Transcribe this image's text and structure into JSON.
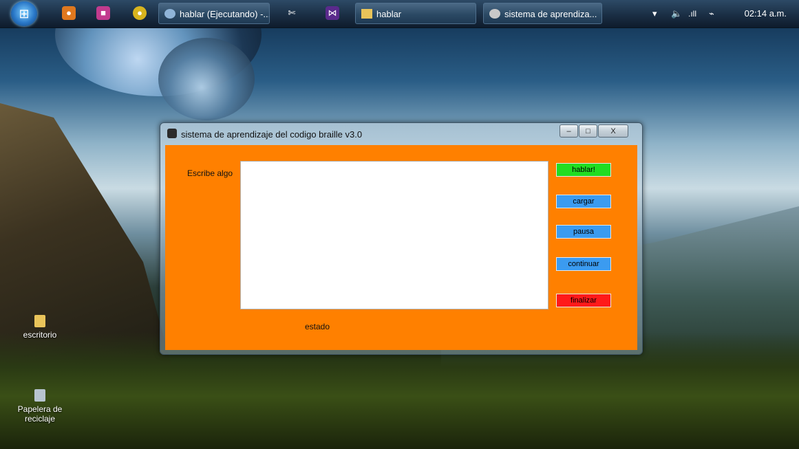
{
  "taskbar": {
    "tasks": [
      {
        "label": "hablar (Ejecutando) -..."
      },
      {
        "label": "hablar"
      },
      {
        "label": "sistema de aprendiza..."
      }
    ],
    "clock": "02:14 a.m."
  },
  "desktop": {
    "icons": [
      {
        "label": "escritorio"
      },
      {
        "label": "Papelera de reciclaje"
      }
    ]
  },
  "window": {
    "title": "sistema de aprendizaje del codigo braille v3.0",
    "minimize_glyph": "–",
    "maximize_glyph": "□",
    "close_glyph": "X",
    "input_label": "Escribe algo",
    "text_value": "",
    "status_label": "estado",
    "buttons": {
      "hablar": "hablar!",
      "cargar": "cargar",
      "pausa": "pausa",
      "continuar": "continuar",
      "finalizar": "finalizar"
    }
  },
  "colors": {
    "client_bg": "#ff8000",
    "hablar_bg": "#22dd22",
    "blue_bg": "#3b9bf0",
    "finalizar_bg": "#ff1a1a"
  }
}
